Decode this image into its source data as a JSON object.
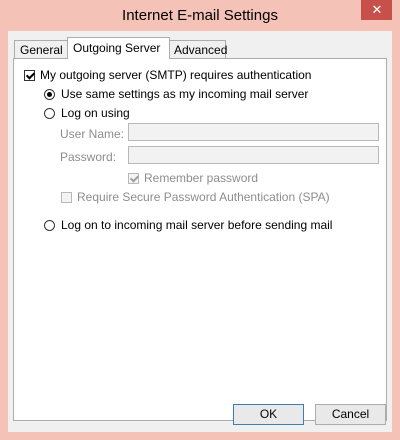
{
  "window": {
    "title": "Internet E-mail Settings",
    "close_icon": "close-icon"
  },
  "tabs": [
    {
      "label": "General",
      "active": false
    },
    {
      "label": "Outgoing Server",
      "active": true
    },
    {
      "label": "Advanced",
      "active": false
    }
  ],
  "outgoing": {
    "requires_auth": {
      "label": "My outgoing server (SMTP) requires authentication",
      "checked": true
    },
    "use_same_settings": {
      "label": "Use same settings as my incoming mail server",
      "selected": true
    },
    "log_on_using": {
      "label": "Log on using",
      "selected": false
    },
    "user_name": {
      "label": "User Name:",
      "value": ""
    },
    "password": {
      "label": "Password:",
      "value": ""
    },
    "remember_password": {
      "label": "Remember password",
      "checked": true,
      "enabled": false
    },
    "spa": {
      "label": "Require Secure Password Authentication (SPA)",
      "checked": false,
      "enabled": false
    },
    "log_on_incoming": {
      "label": "Log on to incoming mail server before sending mail",
      "selected": false
    }
  },
  "buttons": {
    "ok": "OK",
    "cancel": "Cancel"
  },
  "colors": {
    "frame": "#f4c2b6",
    "close": "#c7504a",
    "default_button_border": "#3c7fb1"
  }
}
